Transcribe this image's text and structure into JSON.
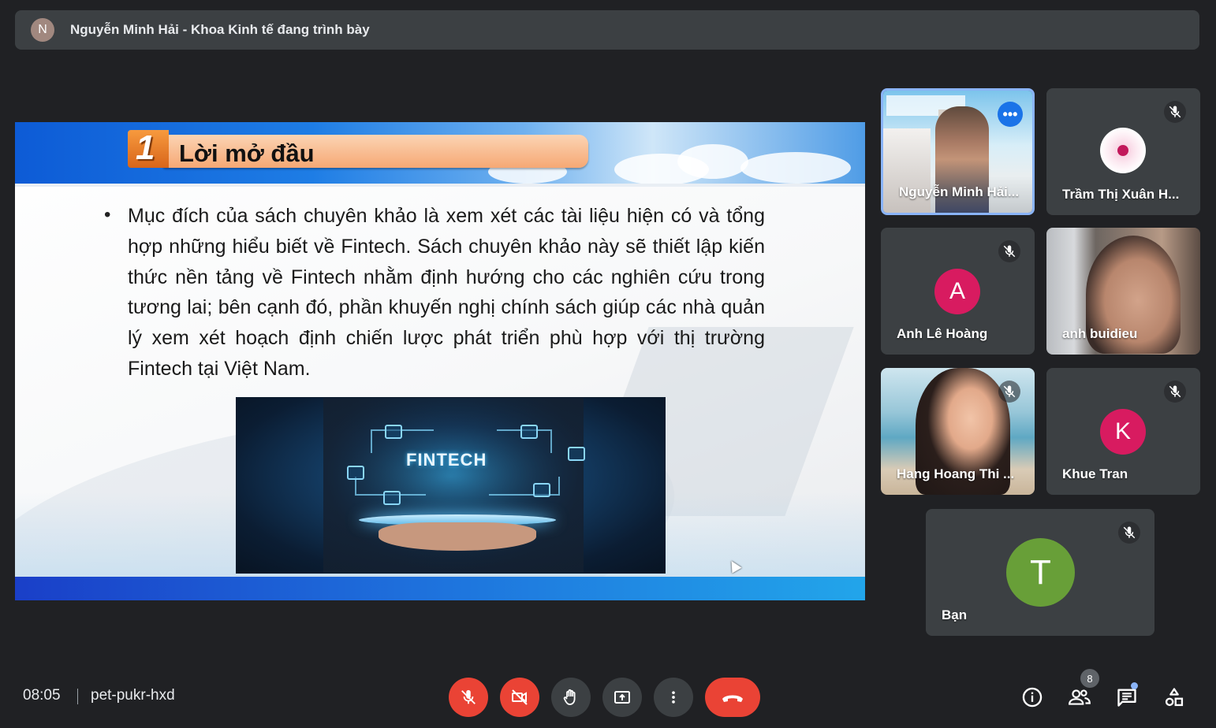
{
  "presenter_banner": {
    "avatar_letter": "N",
    "text": "Nguyễn Minh Hải - Khoa Kinh tế đang trình bày"
  },
  "slide": {
    "number": "1",
    "title": "Lời mở đầu",
    "bullet": "•",
    "body": "Mục đích của sách chuyên khảo là xem xét các tài liệu hiện có và tổng hợp những hiểu biết về Fintech. Sách chuyên khảo này sẽ thiết lập kiến thức nền tảng về Fintech nhằm định hướng cho các nghiên cứu trong tương lai; bên cạnh đó, phần khuyến nghị chính sách giúp các nhà quản lý xem xét hoạch định chiến lược phát triển phù hợp với thị trường Fintech tại Việt Nam.",
    "image_label": "FINTECH"
  },
  "participants": [
    {
      "name": "Nguyễn Minh Hải...",
      "type": "video",
      "muted": false
    },
    {
      "name": "Trầm Thị Xuân H...",
      "type": "photo",
      "muted": true
    },
    {
      "name": "Anh Lê Hoàng",
      "type": "avatar",
      "letter": "A",
      "color": "#d81b60",
      "muted": true
    },
    {
      "name": "anh buidieu",
      "type": "video",
      "muted": false
    },
    {
      "name": "Hang Hoang Thi ...",
      "type": "video",
      "muted": true
    },
    {
      "name": "Khue Tran",
      "type": "avatar",
      "letter": "K",
      "color": "#d81b60",
      "muted": true
    },
    {
      "name": "Bạn",
      "type": "avatar",
      "letter": "T",
      "color": "#689f38",
      "muted": true
    }
  ],
  "toolbar": {
    "time": "08:05",
    "meeting_code": "pet-pukr-hxd",
    "people_count": "8",
    "controls": [
      "mic-off",
      "camera-off",
      "raise-hand",
      "present-screen",
      "more-options",
      "leave-call"
    ],
    "right_icons": [
      "meeting-details",
      "people",
      "chat",
      "activities"
    ]
  },
  "colors": {
    "background": "#202124",
    "tile": "#3c4043",
    "danger": "#ea4335",
    "accent": "#8ab4f8"
  }
}
